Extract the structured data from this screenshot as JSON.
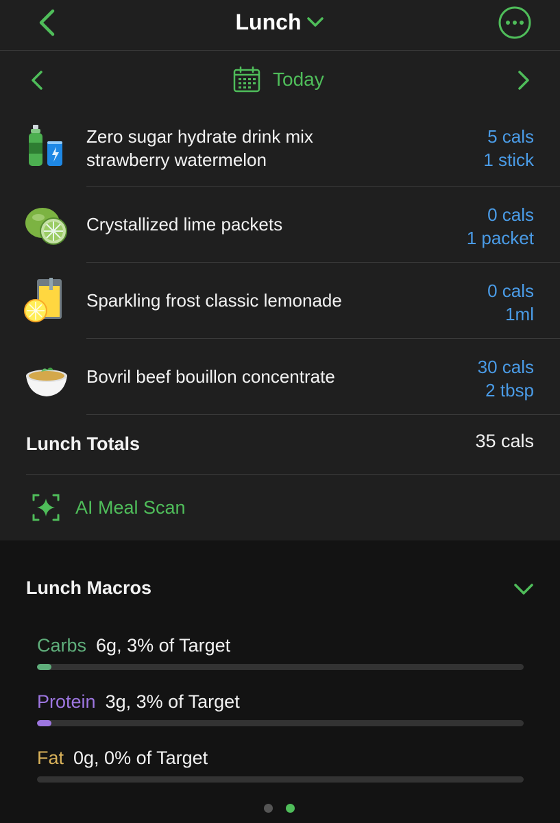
{
  "colors": {
    "accent": "#4fbd5a",
    "link": "#4a9be6",
    "carbs": "#5fae7b",
    "protein": "#9d76e0",
    "fat": "#d9b25a"
  },
  "header": {
    "title": "Lunch",
    "back_icon": "chevron-left-icon",
    "more_icon": "ellipsis-circle-icon"
  },
  "datebar": {
    "label": "Today",
    "icon": "calendar-icon"
  },
  "foods": [
    {
      "name_line1": "Zero sugar hydrate drink mix",
      "name_line2": "strawberry watermelon",
      "cals": "5 cals",
      "serving": "1 stick",
      "icon": "drink-bottle-can-icon"
    },
    {
      "name_line1": "Crystallized lime packets",
      "name_line2": "",
      "cals": "0 cals",
      "serving": "1 packet",
      "icon": "lime-icon"
    },
    {
      "name_line1": "Sparkling frost classic lemonade",
      "name_line2": "",
      "cals": "0 cals",
      "serving": "1ml",
      "icon": "lemonade-icon"
    },
    {
      "name_line1": "Bovril beef bouillon concentrate",
      "name_line2": "",
      "cals": "30 cals",
      "serving": "2 tbsp",
      "icon": "soup-bowl-icon"
    }
  ],
  "totals": {
    "label": "Lunch Totals",
    "value": "35 cals"
  },
  "ai_scan": {
    "label": "AI Meal Scan",
    "icon": "sparkle-scan-icon"
  },
  "macros": {
    "title": "Lunch Macros",
    "items": [
      {
        "name": "Carbs",
        "detail": "6g, 3% of Target",
        "percent": 3
      },
      {
        "name": "Protein",
        "detail": "3g, 3% of Target",
        "percent": 3
      },
      {
        "name": "Fat",
        "detail": "0g, 0% of Target",
        "percent": 0
      }
    ]
  },
  "pager": {
    "pages": 2,
    "current": 2
  }
}
